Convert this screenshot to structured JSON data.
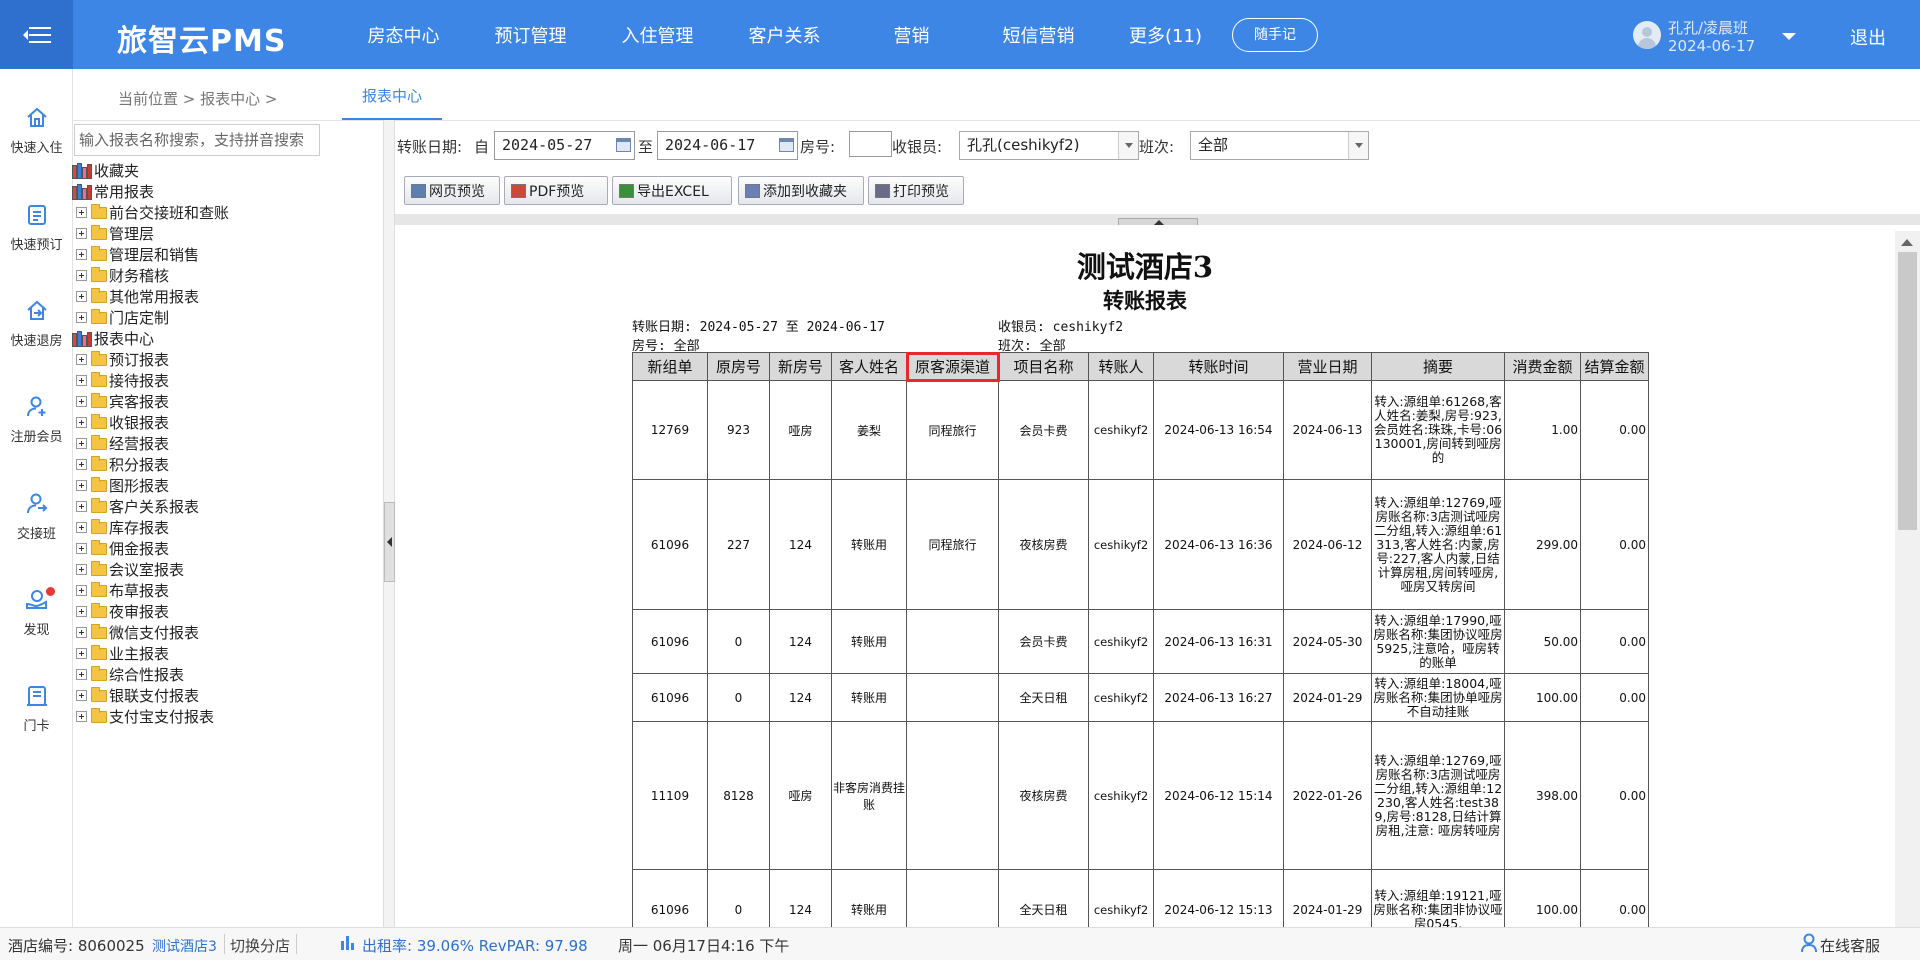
{
  "app": {
    "brand": "旅智云PMS",
    "nav": [
      "房态中心",
      "预订管理",
      "入住管理",
      "客户关系",
      "营销",
      "短信营销",
      "更多(11)"
    ],
    "notes_button": "随手记",
    "user_name": "孔孔/凌晨班",
    "user_date": "2024-06-17",
    "logout": "退出",
    "accent": "#3d86e6"
  },
  "rail": [
    {
      "label": "快速入住",
      "icon": "home-icon"
    },
    {
      "label": "快速预订",
      "icon": "booking-icon"
    },
    {
      "label": "快速退房",
      "icon": "checkout-icon"
    },
    {
      "label": "注册会员",
      "icon": "add-user-icon"
    },
    {
      "label": "交接班",
      "icon": "shift-icon"
    },
    {
      "label": "发现",
      "icon": "discover-icon"
    },
    {
      "label": "门卡",
      "icon": "card-icon"
    }
  ],
  "breadcrumb": "当前位置 > 报表中心 >",
  "active_tab": "报表中心",
  "search": {
    "placeholder": "输入报表名称搜索，支持拼音搜索"
  },
  "tree": [
    {
      "label": "收藏夹",
      "level": 0,
      "icon": "books-icon"
    },
    {
      "label": "常用报表",
      "level": 0,
      "icon": "books-icon"
    },
    {
      "label": "前台交接班和查账",
      "level": 1,
      "icon": "folder-icon"
    },
    {
      "label": "管理层",
      "level": 1,
      "icon": "folder-icon"
    },
    {
      "label": "管理层和销售",
      "level": 1,
      "icon": "folder-icon"
    },
    {
      "label": "财务稽核",
      "level": 1,
      "icon": "folder-icon"
    },
    {
      "label": "其他常用报表",
      "level": 1,
      "icon": "folder-icon"
    },
    {
      "label": "门店定制",
      "level": 1,
      "icon": "folder-icon"
    },
    {
      "label": "报表中心",
      "level": 0,
      "icon": "books-icon"
    },
    {
      "label": "预订报表",
      "level": 1,
      "icon": "folder-icon"
    },
    {
      "label": "接待报表",
      "level": 1,
      "icon": "folder-icon"
    },
    {
      "label": "宾客报表",
      "level": 1,
      "icon": "folder-icon"
    },
    {
      "label": "收银报表",
      "level": 1,
      "icon": "folder-icon"
    },
    {
      "label": "经营报表",
      "level": 1,
      "icon": "folder-icon"
    },
    {
      "label": "积分报表",
      "level": 1,
      "icon": "folder-icon"
    },
    {
      "label": "图形报表",
      "level": 1,
      "icon": "folder-icon"
    },
    {
      "label": "客户关系报表",
      "level": 1,
      "icon": "folder-icon"
    },
    {
      "label": "库存报表",
      "level": 1,
      "icon": "folder-icon"
    },
    {
      "label": "佣金报表",
      "level": 1,
      "icon": "folder-icon"
    },
    {
      "label": "会议室报表",
      "level": 1,
      "icon": "folder-icon"
    },
    {
      "label": "布草报表",
      "level": 1,
      "icon": "folder-icon"
    },
    {
      "label": "夜审报表",
      "level": 1,
      "icon": "folder-icon"
    },
    {
      "label": "微信支付报表",
      "level": 1,
      "icon": "folder-icon"
    },
    {
      "label": "业主报表",
      "level": 1,
      "icon": "folder-icon"
    },
    {
      "label": "综合性报表",
      "level": 1,
      "icon": "folder-icon"
    },
    {
      "label": "银联支付报表",
      "level": 1,
      "icon": "folder-icon"
    },
    {
      "label": "支付宝支付报表",
      "level": 1,
      "icon": "folder-icon"
    }
  ],
  "filters": {
    "date_label": "转账日期:",
    "from_label": "自",
    "date_from": "2024-05-27",
    "to_label": "至",
    "date_to": "2024-06-17",
    "room_label": "房号:",
    "room_value": "",
    "cashier_label": "收银员:",
    "cashier_value": "孔孔(ceshikyf2)",
    "shift_label": "班次:",
    "shift_value": "全部"
  },
  "toolbar": [
    "网页预览",
    "PDF预览",
    "导出EXCEL",
    "添加到收藏夹",
    "打印预览"
  ],
  "report": {
    "hotel": "测试酒店3",
    "title": "转账报表",
    "meta_date": "转账日期: 2024-05-27 至 2024-06-17",
    "meta_room": "房号: 全部",
    "meta_cashier": "收银员: ceshikyf2",
    "meta_shift": "班次: 全部",
    "columns": [
      "新组单",
      "原房号",
      "新房号",
      "客人姓名",
      "原客源渠道",
      "项目名称",
      "转账人",
      "转账时间",
      "营业日期",
      "摘要",
      "消费金额",
      "结算金额"
    ],
    "highlight_color": "#e8282b",
    "rows": [
      [
        "12769",
        "923",
        "哑房",
        "姜梨",
        "同程旅行",
        "会员卡费",
        "ceshikyf2",
        "2024-06-13 16:54",
        "2024-06-13",
        "转入:源组单:61268,客人姓名:姜梨,房号:923,会员姓名:珠珠,卡号:06130001,房间转到哑房的",
        "1.00",
        "0.00"
      ],
      [
        "61096",
        "227",
        "124",
        "转账用",
        "同程旅行",
        "夜核房费",
        "ceshikyf2",
        "2024-06-13 16:36",
        "2024-06-12",
        "转入:源组单:12769,哑房账名称:3店测试哑房二分组,转入:源组单:61313,客人姓名:内蒙,房号:227,客人内蒙,日结计算房租,房间转哑房,哑房又转房间",
        "299.00",
        "0.00"
      ],
      [
        "61096",
        "0",
        "124",
        "转账用",
        "",
        "会员卡费",
        "ceshikyf2",
        "2024-06-13 16:31",
        "2024-05-30",
        "转入:源组单:17990,哑房账名称:集团协议哑房5925,注意哈，哑房转的账单",
        "50.00",
        "0.00"
      ],
      [
        "61096",
        "0",
        "124",
        "转账用",
        "",
        "全天日租",
        "ceshikyf2",
        "2024-06-13 16:27",
        "2024-01-29",
        "转入:源组单:18004,哑房账名称:集团协单哑房不自动挂账",
        "100.00",
        "0.00"
      ],
      [
        "11109",
        "8128",
        "哑房",
        "非客房消费挂账",
        "",
        "夜核房费",
        "ceshikyf2",
        "2024-06-12 15:14",
        "2022-01-26",
        "转入:源组单:12769,哑房账名称:3店测试哑房二分组,转入:源组单:12230,客人姓名:test389,房号:8128,日结计算房租,注意: 哑房转哑房",
        "398.00",
        "0.00"
      ],
      [
        "61096",
        "0",
        "124",
        "转账用",
        "",
        "全天日租",
        "ceshikyf2",
        "2024-06-12 15:13",
        "2024-01-29",
        "转入:源组单:19121,哑房账名称:集团非协议哑房0545,",
        "100.00",
        "0.00"
      ]
    ]
  },
  "status": {
    "hotel_code": "酒店编号: 8060025",
    "hotel_name": "测试酒店3",
    "switch": "切换分店",
    "occupancy": "出租率: 39.06% RevPAR: 97.98",
    "datetime": "周一 06月17日4:16 下午",
    "support": "在线客服"
  }
}
